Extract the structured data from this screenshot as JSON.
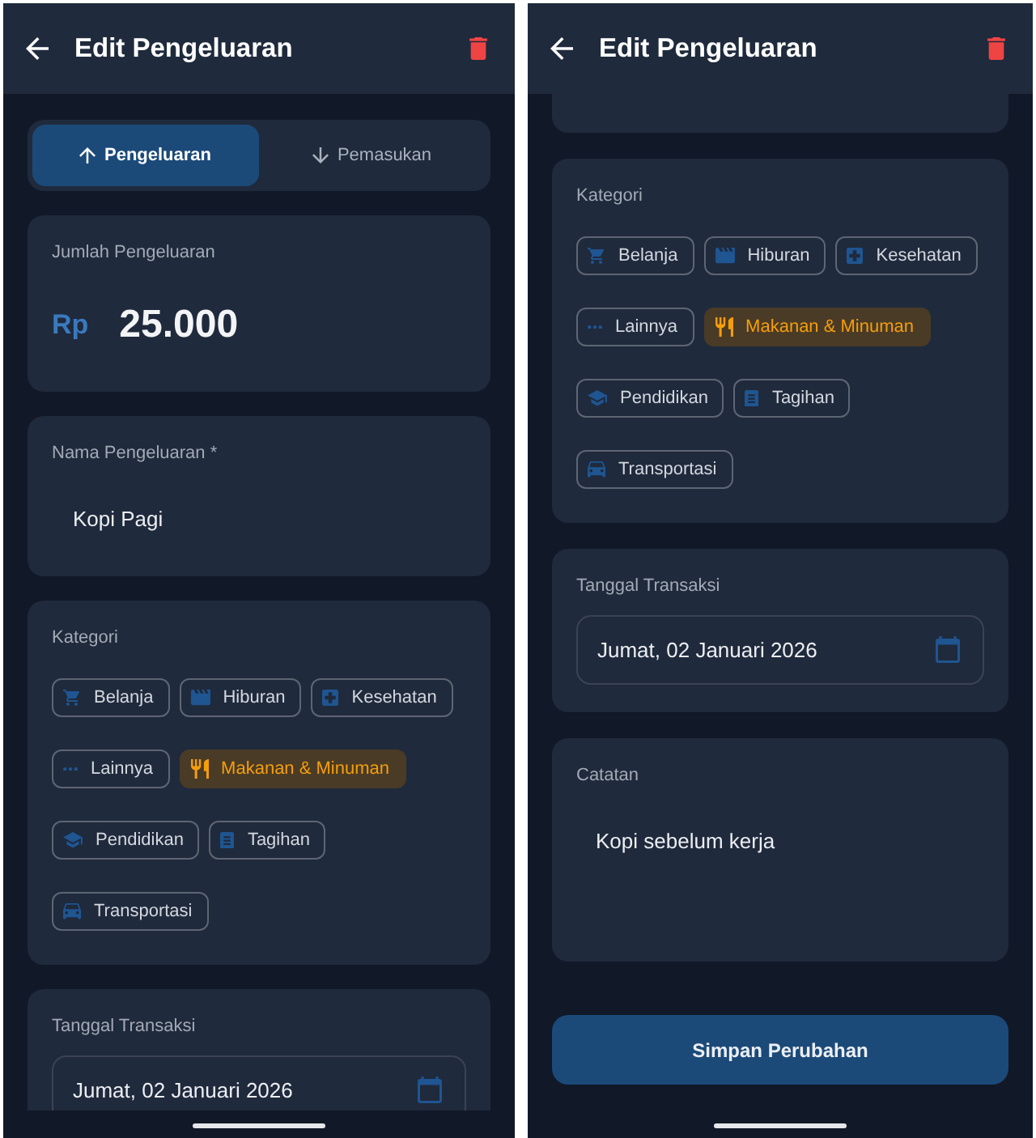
{
  "screens": [
    {
      "app_bar": {
        "title": "Edit Pengeluaran"
      },
      "sections": [
        {
          "kind": "type_toggle",
          "options": [
            {
              "label": "Pengeluaran",
              "selected": true
            },
            {
              "label": "Pemasukan",
              "selected": false
            }
          ]
        },
        {
          "kind": "amount",
          "label": "Jumlah Pengeluaran",
          "currency": "Rp",
          "value": "25.000"
        },
        {
          "kind": "text",
          "label": "Nama Pengeluaran *",
          "value": "Kopi Pagi"
        },
        {
          "kind": "categories",
          "label": "Kategori",
          "items": [
            {
              "label": "Belanja",
              "selected": false
            },
            {
              "label": "Hiburan",
              "selected": false
            },
            {
              "label": "Kesehatan",
              "selected": false
            },
            {
              "label": "Lainnya",
              "selected": false
            },
            {
              "label": "Makanan & Minuman",
              "selected": true
            },
            {
              "label": "Pendidikan",
              "selected": false
            },
            {
              "label": "Tagihan",
              "selected": false
            },
            {
              "label": "Transportasi",
              "selected": false
            }
          ]
        },
        {
          "kind": "date",
          "label": "Tanggal Transaksi",
          "value": "Jumat, 02 Januari 2026"
        }
      ]
    },
    {
      "app_bar": {
        "title": "Edit Pengeluaran"
      },
      "sections": [
        {
          "kind": "card_end"
        },
        {
          "kind": "categories",
          "label": "Kategori",
          "items": [
            {
              "label": "Belanja",
              "selected": false
            },
            {
              "label": "Hiburan",
              "selected": false
            },
            {
              "label": "Kesehatan",
              "selected": false
            },
            {
              "label": "Lainnya",
              "selected": false
            },
            {
              "label": "Makanan & Minuman",
              "selected": true
            },
            {
              "label": "Pendidikan",
              "selected": false
            },
            {
              "label": "Tagihan",
              "selected": false
            },
            {
              "label": "Transportasi",
              "selected": false
            }
          ]
        },
        {
          "kind": "date",
          "label": "Tanggal Transaksi",
          "value": "Jumat, 02 Januari 2026"
        },
        {
          "kind": "note",
          "label": "Catatan",
          "value": "Kopi sebelum kerja"
        },
        {
          "kind": "button",
          "label": "Simpan Perubahan"
        }
      ]
    }
  ]
}
